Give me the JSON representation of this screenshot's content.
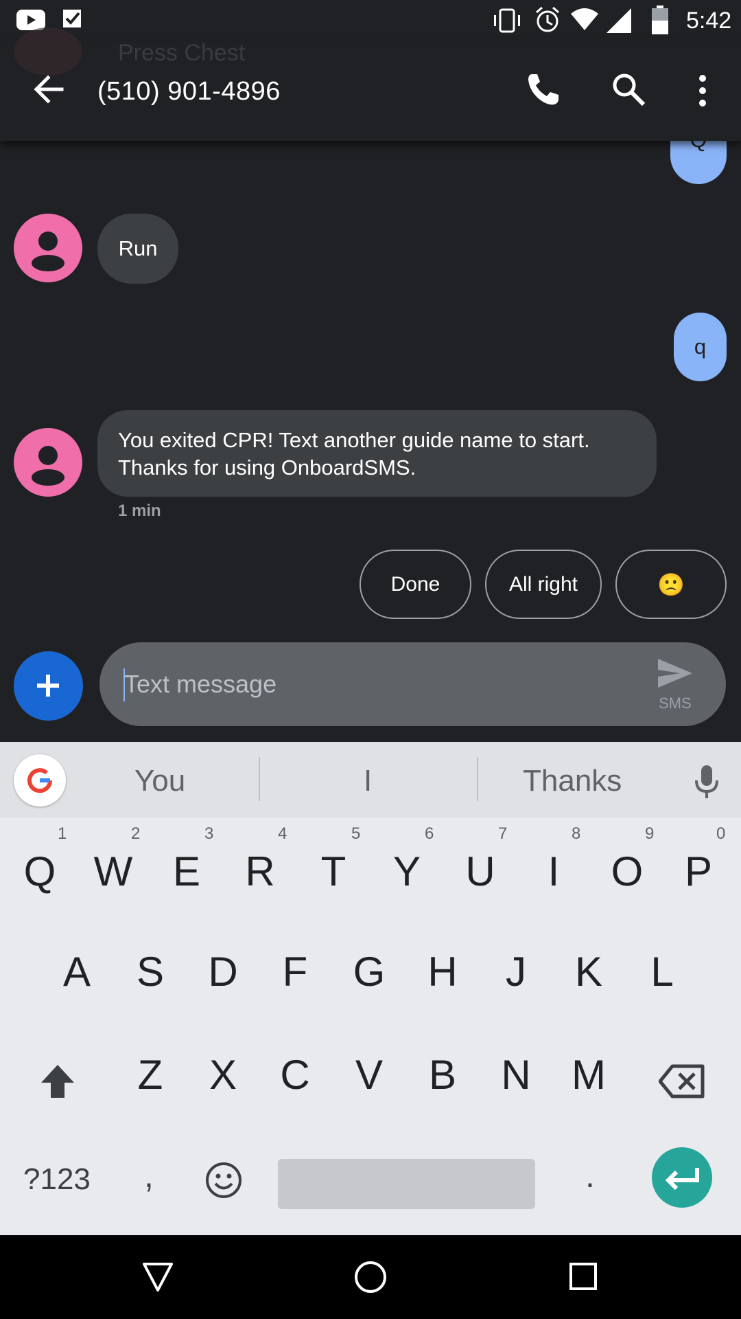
{
  "status_bar": {
    "time": "5:42"
  },
  "app_bar": {
    "peek_name": "Press Chest",
    "title": "(510) 901-4896"
  },
  "messages": {
    "peek_out": "Q",
    "in1": "Run",
    "out1": "q",
    "in2_line1": "You exited CPR! Text another guide name to start.",
    "in2_line2": "Thanks for using OnboardSMS.",
    "in2_time": "1 min"
  },
  "smart_replies": [
    "Done",
    "All right",
    "🙁"
  ],
  "composer": {
    "placeholder": "Text message",
    "send_label": "SMS"
  },
  "keyboard": {
    "suggestions": [
      "You",
      "I",
      "Thanks"
    ],
    "row1": [
      "Q",
      "W",
      "E",
      "R",
      "T",
      "Y",
      "U",
      "I",
      "O",
      "P"
    ],
    "row1_hints": [
      "1",
      "2",
      "3",
      "4",
      "5",
      "6",
      "7",
      "8",
      "9",
      "0"
    ],
    "row2": [
      "A",
      "S",
      "D",
      "F",
      "G",
      "H",
      "J",
      "K",
      "L"
    ],
    "row3": [
      "Z",
      "X",
      "C",
      "V",
      "B",
      "N",
      "M"
    ],
    "symbols_label": "?123",
    "comma": ",",
    "period": "."
  },
  "colors": {
    "background": "#202124",
    "incoming_bubble": "#3c4043",
    "outgoing_bubble": "#8ab4f8",
    "avatar": "#f06eaa",
    "accent": "#1967d2",
    "enter_key": "#26a69a"
  }
}
